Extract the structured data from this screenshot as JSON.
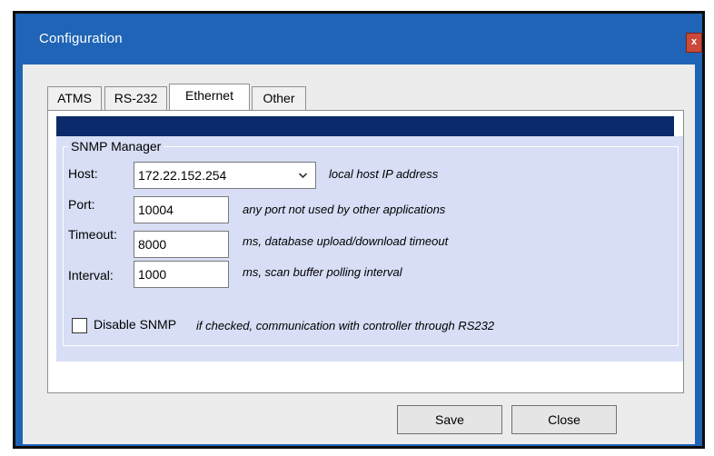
{
  "window": {
    "title": "Configuration",
    "close_glyph": "x"
  },
  "tabs": [
    {
      "label": "ATMS"
    },
    {
      "label": "RS-232"
    },
    {
      "label": "Ethernet",
      "active": true
    },
    {
      "label": "Other"
    }
  ],
  "snmp": {
    "group_title": "SNMP Manager",
    "host": {
      "label": "Host:",
      "value": "172.22.152.254",
      "hint": "local host IP address"
    },
    "port": {
      "label": "Port:",
      "value": "10004",
      "hint": "any port not used by other applications"
    },
    "timeout": {
      "label": "Timeout:",
      "value": "8000",
      "hint": "ms,  database upload/download timeout"
    },
    "interval": {
      "label": "Interval:",
      "value": "1000",
      "hint": "ms,  scan buffer polling interval"
    },
    "disable": {
      "label": "Disable SNMP",
      "checked": false,
      "hint": "if checked, communication with controller through RS232"
    }
  },
  "buttons": {
    "save": "Save",
    "close": "Close"
  },
  "icons": {
    "dropdown": "chevron-down-icon",
    "close": "close-icon"
  },
  "colors": {
    "titlebar": "#1f64b6",
    "header_bar": "#0a2a6b",
    "panel": "#d7def5",
    "close_button": "#c94a3a"
  }
}
